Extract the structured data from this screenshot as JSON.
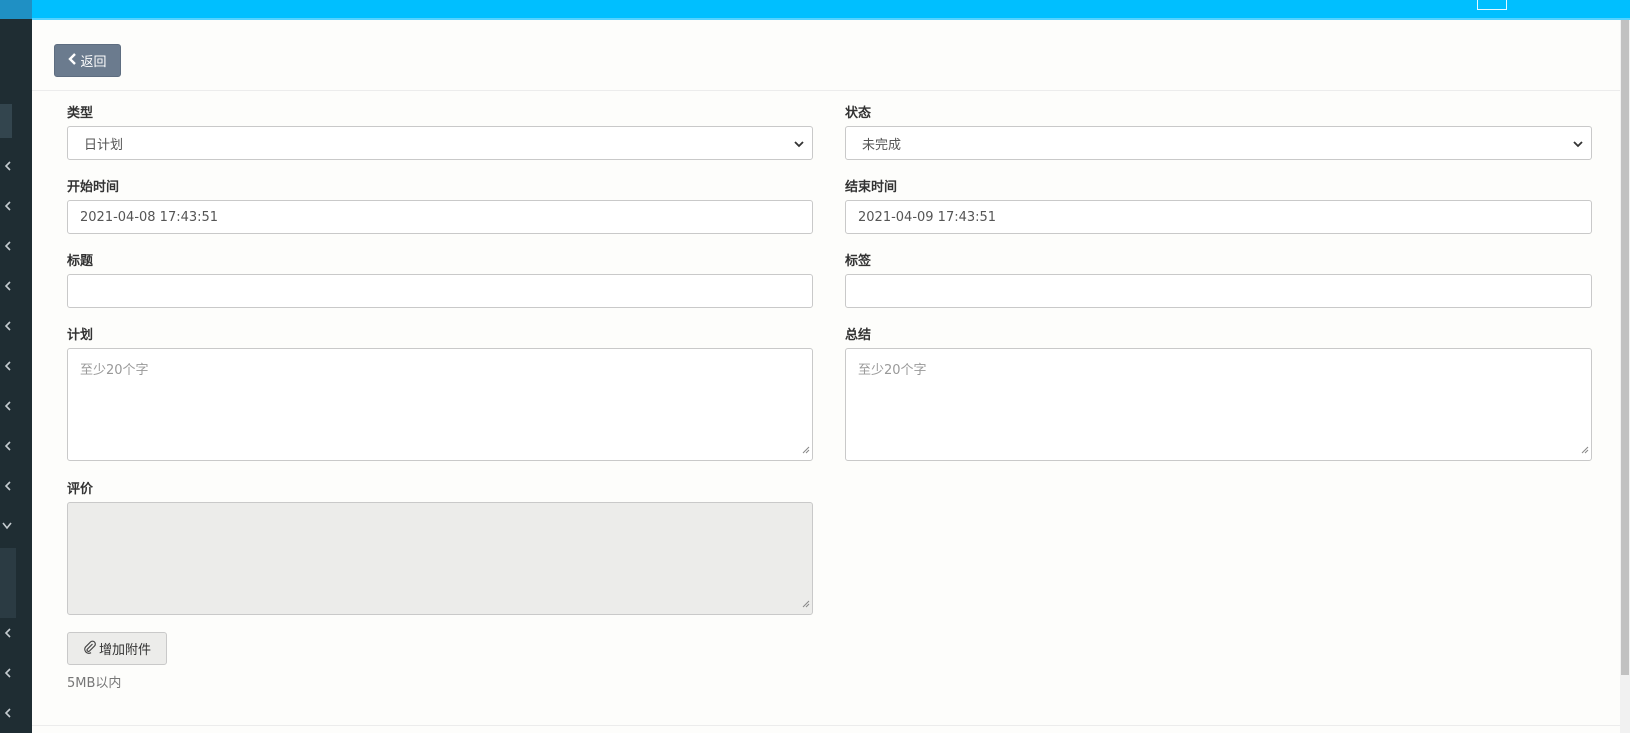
{
  "header": {
    "back_label": "返回"
  },
  "form": {
    "type": {
      "label": "类型",
      "value": "日计划"
    },
    "status": {
      "label": "状态",
      "value": "未完成"
    },
    "start_time": {
      "label": "开始时间",
      "value": "2021-04-08 17:43:51"
    },
    "end_time": {
      "label": "结束时间",
      "value": "2021-04-09 17:43:51"
    },
    "title": {
      "label": "标题",
      "value": ""
    },
    "tags": {
      "label": "标签",
      "value": ""
    },
    "plan": {
      "label": "计划",
      "placeholder": "至少20个字"
    },
    "summary": {
      "label": "总结",
      "placeholder": "至少20个字"
    },
    "evaluation": {
      "label": "评价",
      "value": ""
    },
    "attach_label": "增加附件",
    "size_hint": "5MB以内"
  },
  "icons": {
    "back": "chevron-left-icon",
    "attach": "paperclip-icon",
    "sidebar": "chevron-left-icon"
  },
  "colors": {
    "topbar": "#00bfff",
    "sidebar": "#1f2d33",
    "back_button": "#6b7b8e"
  }
}
